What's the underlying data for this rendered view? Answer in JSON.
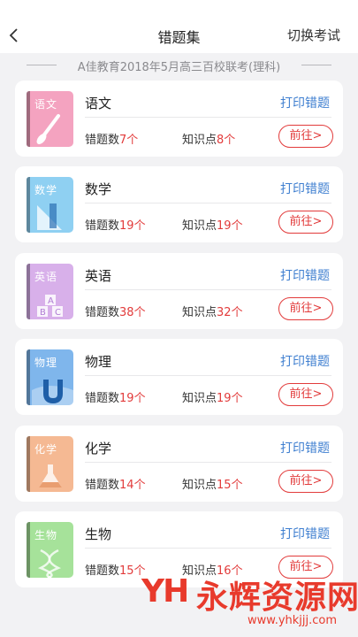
{
  "header": {
    "title": "错题集",
    "right_action": "切换考试"
  },
  "exam_name": "A佳教育2018年5月高三百校联考(理科)",
  "labels": {
    "print": "打印错题",
    "wrong_prefix": "错题数",
    "point_prefix": "知识点",
    "unit": "个",
    "go": "前往>"
  },
  "subjects": [
    {
      "name": "语文",
      "book_title": "语文",
      "icon": "paintbrush-icon",
      "color": "#f4a3c0",
      "wrong": "7",
      "points": "8"
    },
    {
      "name": "数学",
      "book_title": "数学",
      "icon": "ruler-triangle-icon",
      "color": "#8fd0f2",
      "wrong": "19",
      "points": "19"
    },
    {
      "name": "英语",
      "book_title": "英语",
      "icon": "abc-blocks-icon",
      "color": "#d8b0ea",
      "wrong": "38",
      "points": "32"
    },
    {
      "name": "物理",
      "book_title": "物理",
      "icon": "magnet-icon",
      "color": "#7fb6ec",
      "wrong": "19",
      "points": "19"
    },
    {
      "name": "化学",
      "book_title": "化学",
      "icon": "flask-icon",
      "color": "#f5b993",
      "wrong": "14",
      "points": "15"
    },
    {
      "name": "生物",
      "book_title": "生物",
      "icon": "dna-icon",
      "color": "#a6e29a",
      "wrong": "15",
      "points": "16"
    }
  ],
  "watermark": {
    "logo_text": "YH",
    "name": "永辉资源网",
    "url": "www.yhkjjj.com"
  }
}
